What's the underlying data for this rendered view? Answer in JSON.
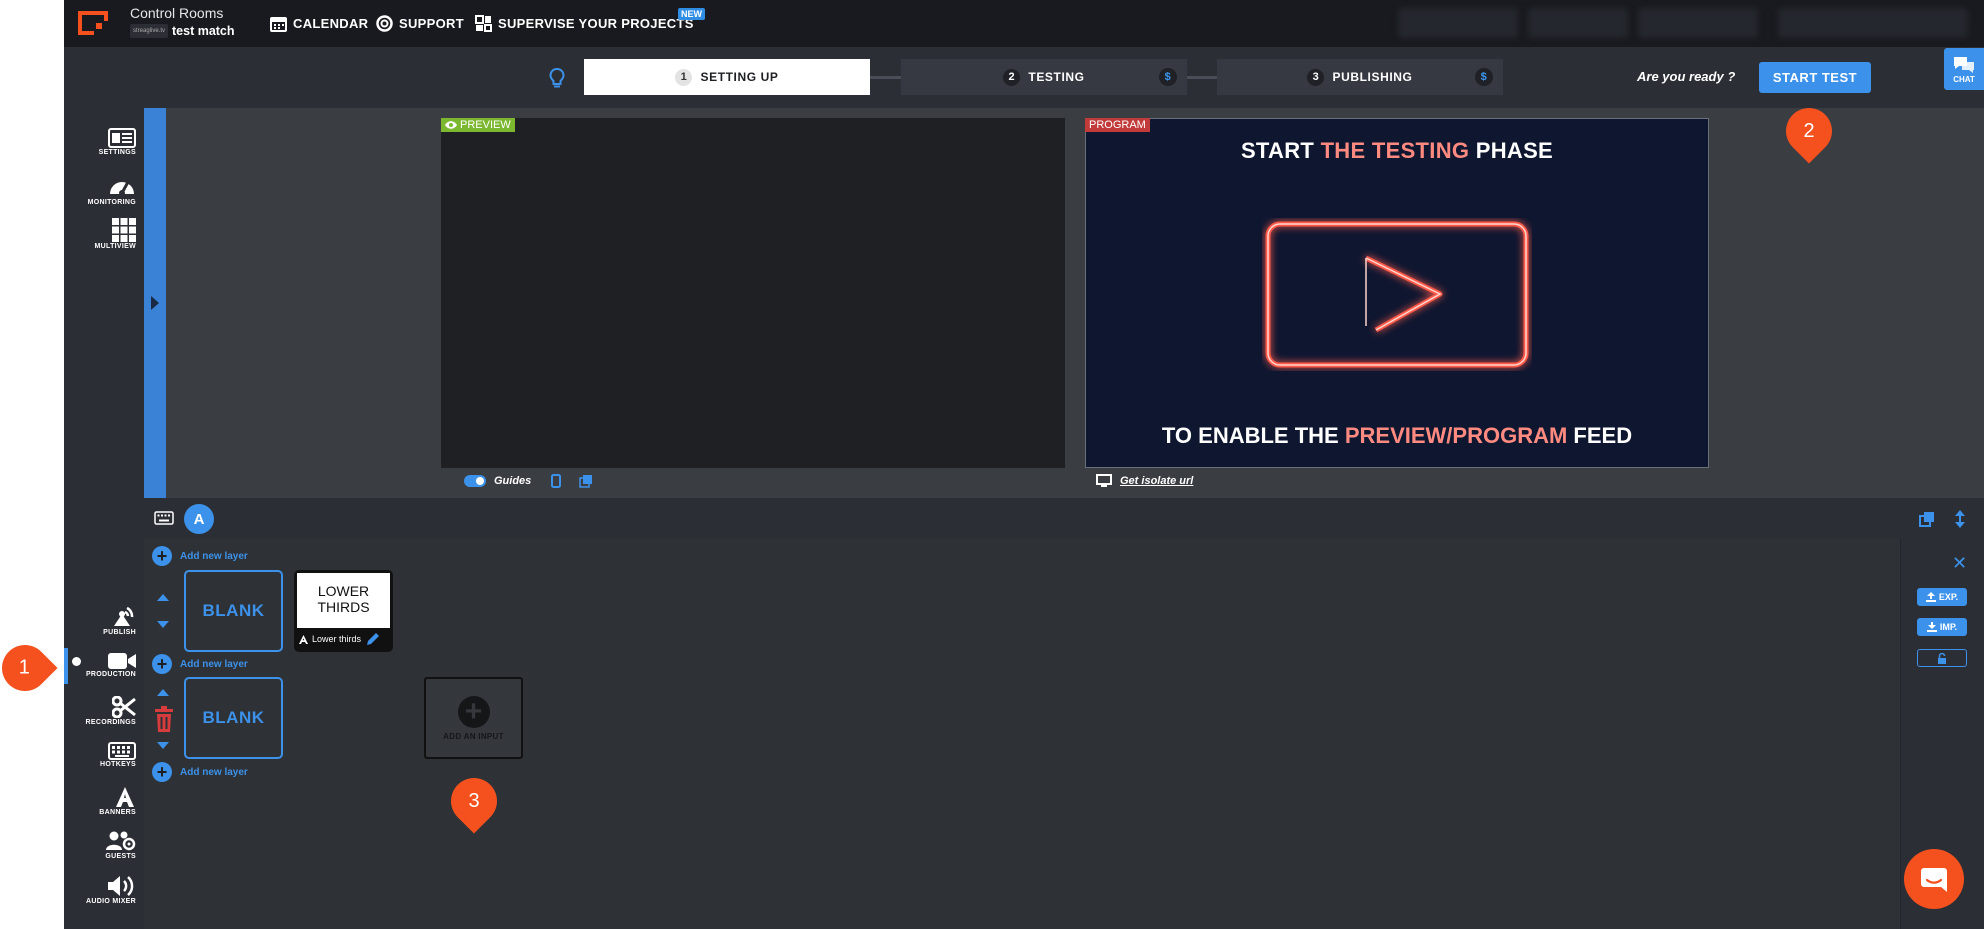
{
  "topbar": {
    "section": "Control Rooms",
    "project": "test match",
    "project_logo_text": "streaglive.tv",
    "nav": [
      {
        "label": "CALENDAR",
        "icon": "calendar-icon"
      },
      {
        "label": "SUPPORT",
        "icon": "lifebuoy-icon"
      },
      {
        "label": "SUPERVISE YOUR PROJECTS",
        "icon": "grid-icon"
      }
    ],
    "new_badge": "NEW"
  },
  "workflow": {
    "steps": [
      {
        "num": "1",
        "label": "SETTING UP"
      },
      {
        "num": "2",
        "label": "TESTING",
        "price": "$"
      },
      {
        "num": "3",
        "label": "PUBLISHING",
        "price": "$"
      }
    ],
    "ready_text": "Are you ready ?",
    "start_button": "START TEST",
    "chat_label": "CHAT"
  },
  "sidebar": {
    "top": [
      {
        "label": "SETTINGS",
        "icon": "settings-icon"
      },
      {
        "label": "MONITORING",
        "icon": "gauge-icon"
      },
      {
        "label": "MULTIVIEW",
        "icon": "multiview-icon"
      }
    ],
    "bottom": [
      {
        "label": "PUBLISH",
        "icon": "broadcast-icon"
      },
      {
        "label": "PRODUCTION",
        "icon": "camera-icon"
      },
      {
        "label": "RECORDINGS",
        "icon": "scissors-icon"
      },
      {
        "label": "HOTKEYS",
        "icon": "keyboard-icon"
      },
      {
        "label": "BANNERS",
        "icon": "text-a-icon"
      },
      {
        "label": "GUESTS",
        "icon": "guests-icon"
      },
      {
        "label": "AUDIO MIXER",
        "icon": "speaker-icon"
      }
    ]
  },
  "preview": {
    "label": "PREVIEW",
    "guides_label": "Guides"
  },
  "program": {
    "label": "PROGRAM",
    "title_a": "START ",
    "title_b": "THE TESTING",
    "title_c": " PHASE",
    "bottom_a": "TO ENABLE THE ",
    "bottom_b": "PREVIEW/PROGRAM",
    "bottom_c": " FEED",
    "isolate_link": "Get isolate url"
  },
  "layers": {
    "avatar_letter": "A",
    "add_layer_label": "Add new layer",
    "blank_label": "BLANK",
    "lower_thirds_title": "LOWER THIRDS",
    "lower_thirds_name": "Lower thirds",
    "add_input_label": "ADD AN INPUT"
  },
  "rightpanel": {
    "export_label": "EXP.",
    "import_label": "IMP."
  },
  "markers": [
    "1",
    "2",
    "3"
  ],
  "colors": {
    "accent": "#3c92ea",
    "preview": "#7cb82f",
    "program": "#c23b3b",
    "marker": "#f4511e"
  }
}
